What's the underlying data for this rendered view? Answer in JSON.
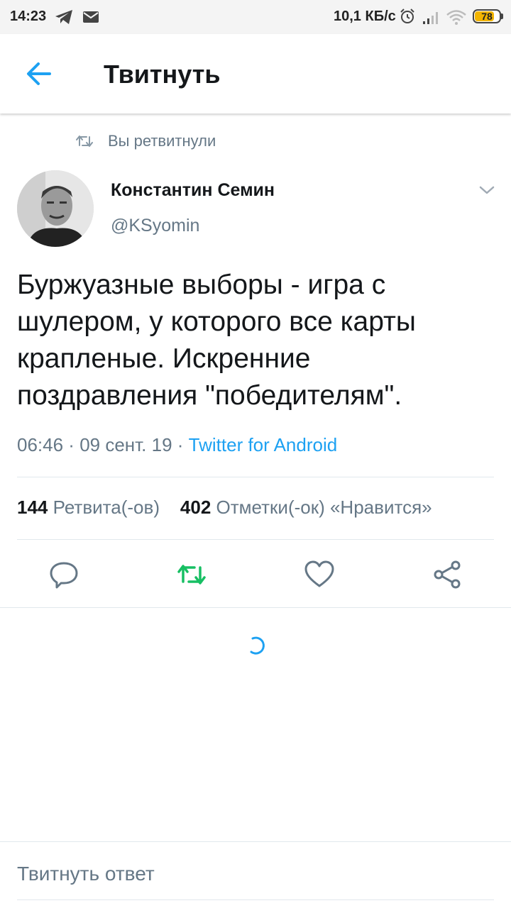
{
  "status_bar": {
    "time": "14:23",
    "speed": "10,1 КБ/с",
    "battery": "78",
    "battery_level": 0.78,
    "icons": [
      "telegram-icon",
      "mail-icon",
      "alarm-icon",
      "signal-icon",
      "wifi-icon",
      "battery-icon"
    ]
  },
  "header": {
    "title": "Твитнуть",
    "back_icon": "arrow-left-icon"
  },
  "retweet_indicator": "Вы ретвитнули",
  "tweet": {
    "author_name": "Константин Семин",
    "author_handle": "@KSyomin",
    "text": "Буржуазные выборы - игра с шулером, у которого все карты крапленые. Искренние поздравления \"победителям\".",
    "time": "06:46",
    "date": "09 сент. 19",
    "source": "Twitter for Android",
    "separator": " · "
  },
  "stats": {
    "retweets_count": "144",
    "retweets_label": "Ретвита(-ов)",
    "likes_count": "402",
    "likes_label": "Отметки(-ок) «Нравится»"
  },
  "actions": [
    "reply-icon",
    "retweet-icon",
    "like-icon",
    "share-icon"
  ],
  "colors": {
    "accent": "#1da1f2",
    "retweet_active": "#17bf63",
    "secondary_text": "#657786",
    "primary_text": "#14171a"
  },
  "reply": {
    "placeholder": "Твитнуть ответ"
  }
}
